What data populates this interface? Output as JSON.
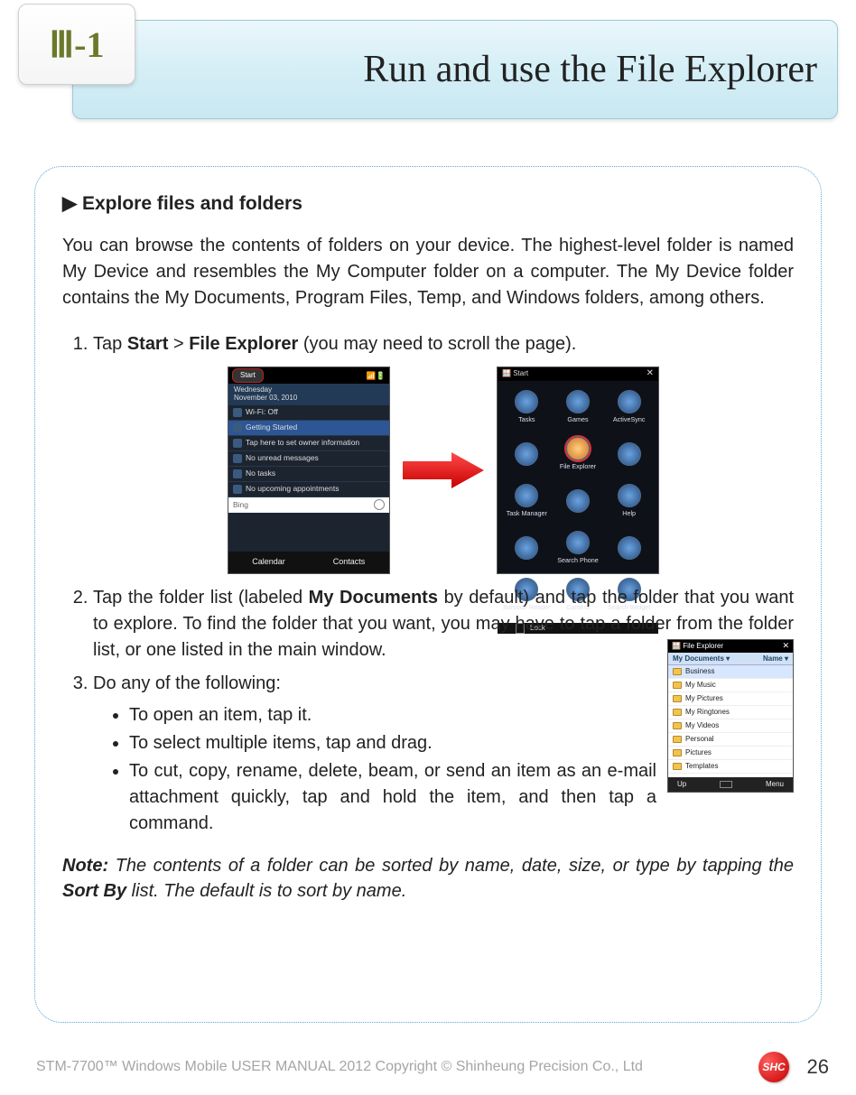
{
  "header": {
    "badge": "Ⅲ-1",
    "title": "Run and use the File Explorer"
  },
  "section": {
    "heading_prefix": "▶",
    "heading": "Explore files and folders",
    "intro": "You can browse the contents of folders on your device. The highest-level folder is named My Device and resembles the My Computer folder on a computer. The My Device folder contains the My Documents, Program Files, Temp, and Windows folders, among others.",
    "step1_pre": "Tap ",
    "step1_b1": "Start",
    "step1_mid": "  > ",
    "step1_b2": "File Explorer",
    "step1_post": " (you may need to scroll the page).",
    "step2_pre": "Tap the folder list (labeled ",
    "step2_b": "My Documents",
    "step2_post": " by default) and tap the folder that you want to explore. To find the folder that you want, you may have to tap a folder from the folder list, or one listed in the main window.",
    "step3": "Do any of the following:",
    "bullets": [
      "To open an item, tap it.",
      "To select multiple items, tap and drag.",
      "To cut, copy, rename, delete, beam, or send an item as an e-mail attachment quickly, tap and hold the item, and then tap a command."
    ],
    "note_label": "Note:",
    "note_pre": " The contents of a folder can be sorted by name, date, size, or type by tapping the ",
    "note_b": "Sort By",
    "note_post": " list. The default is to sort by name."
  },
  "mock1": {
    "start": "Start",
    "date_l1": "Wednesday",
    "date_l2": "November 03, 2010",
    "rows": [
      "Wi-Fi: Off",
      "Getting Started",
      "Tap here to set owner information",
      "No unread messages",
      "No tasks",
      "No upcoming appointments"
    ],
    "bing": "Bing",
    "bot_l": "Calendar",
    "bot_r": "Contacts"
  },
  "mock2": {
    "start": "Start",
    "apps": [
      "Tasks",
      "Games",
      "ActiveSync",
      "",
      "File Explorer",
      "",
      "Task Manager",
      "",
      "Help",
      "",
      "Search Phone",
      "",
      "Barcode Reader",
      "Camera",
      "Search Widget"
    ],
    "lock": "Lock"
  },
  "mock3": {
    "title": "File Explorer",
    "bar_l": "My Documents ▾",
    "bar_r": "Name ▾",
    "items": [
      "Business",
      "My Music",
      "My Pictures",
      "My Ringtones",
      "My Videos",
      "Personal",
      "Pictures",
      "Templates"
    ],
    "bot_l": "Up",
    "bot_r": "Menu"
  },
  "footer": {
    "text": "STM-7700™ Windows Mobile USER MANUAL  2012 Copyright © Shinheung Precision Co., Ltd",
    "logo": "SHC",
    "page": "26"
  }
}
